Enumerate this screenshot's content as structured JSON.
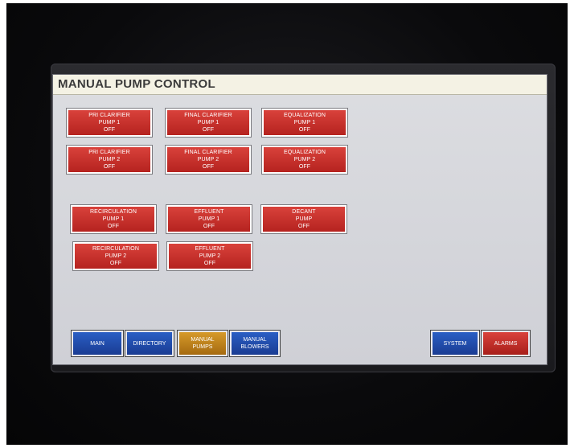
{
  "screen": {
    "title": "MANUAL PUMP CONTROL"
  },
  "pumps": [
    {
      "line1": "PRI CLARIFIER",
      "line2": "PUMP 1",
      "status": "OFF"
    },
    {
      "line1": "FINAL CLARIFIER",
      "line2": "PUMP 1",
      "status": "OFF"
    },
    {
      "line1": "EQUALIZATION",
      "line2": "PUMP 1",
      "status": "OFF"
    },
    {
      "line1": "PRI CLARIFIER",
      "line2": "PUMP 2",
      "status": "OFF"
    },
    {
      "line1": "FINAL CLARIFIER",
      "line2": "PUMP 2",
      "status": "OFF"
    },
    {
      "line1": "EQUALIZATION",
      "line2": "PUMP 2",
      "status": "OFF"
    },
    {
      "line1": "RECIRCULATION",
      "line2": "PUMP 1",
      "status": "OFF"
    },
    {
      "line1": "EFFLUENT",
      "line2": "PUMP 1",
      "status": "OFF"
    },
    {
      "line1": "DECANT",
      "line2": "PUMP",
      "status": "OFF"
    },
    {
      "line1": "RECIRCULATION",
      "line2": "PUMP 2",
      "status": "OFF"
    },
    {
      "line1": "EFFLUENT",
      "line2": "PUMP 2",
      "status": "OFF"
    }
  ],
  "nav": {
    "main": "MAIN",
    "directory": "DIRECTORY",
    "manual_pumps_1": "MANUAL",
    "manual_pumps_2": "PUMPS",
    "manual_blowers_1": "MANUAL",
    "manual_blowers_2": "BLOWERS",
    "system": "SYSTEM",
    "alarms": "ALARMS"
  },
  "colors": {
    "pump_off": "#c0302a",
    "nav_blue": "#1f48a8",
    "nav_active": "#c0841e",
    "alarm": "#c0302a"
  }
}
